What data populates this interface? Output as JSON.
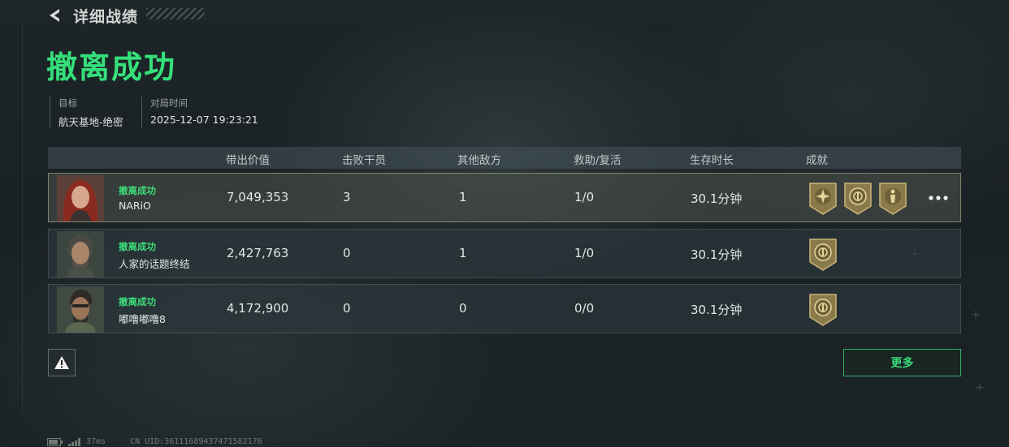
{
  "header": {
    "back_title": "详细战绩"
  },
  "result": {
    "title": "撤离成功"
  },
  "info": {
    "target_label": "目标",
    "target_value": "航天基地-绝密",
    "time_label": "对局时间",
    "time_value": "2025-12-07 19:23:21"
  },
  "table": {
    "columns": [
      "带出价值",
      "击败干员",
      "其他敌方",
      "救助/复活",
      "生存时长",
      "成就"
    ],
    "rows": [
      {
        "status": "撤离成功",
        "name": "NARiO",
        "value": "7,049,353",
        "kills": "3",
        "others": "1",
        "assist": "1/0",
        "survival": "30.1分钟",
        "medals": [
          "star-medal-icon",
          "emblem-medal-icon",
          "figure-medal-icon"
        ],
        "highlighted": true
      },
      {
        "status": "撤离成功",
        "name": "人家的话题终结",
        "value": "2,427,763",
        "kills": "0",
        "others": "1",
        "assist": "1/0",
        "survival": "30.1分钟",
        "medals": [
          "emblem-medal-icon"
        ],
        "highlighted": false
      },
      {
        "status": "撤离成功",
        "name": "嘟噜嘟噜8",
        "value": "4,172,900",
        "kills": "0",
        "others": "0",
        "assist": "0/0",
        "survival": "30.1分钟",
        "medals": [
          "emblem-medal-icon"
        ],
        "highlighted": false
      }
    ]
  },
  "buttons": {
    "more_label": "更多"
  },
  "footer": {
    "ping": "37ms",
    "uid": "CN UID:36111689437471582176"
  },
  "colors": {
    "accent_green": "#35e07a",
    "medal_gold": "#b8a36a"
  }
}
